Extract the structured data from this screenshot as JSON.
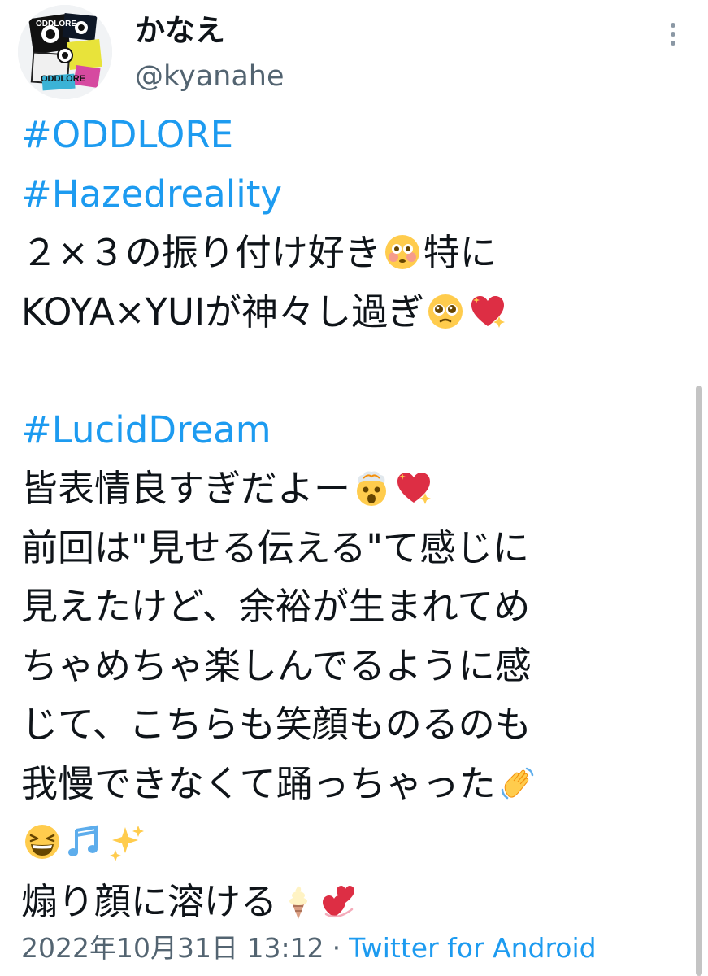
{
  "author": {
    "display_name": "かなえ",
    "handle": "@kyanahe",
    "avatar_text": [
      "ODDLORE",
      "ODDLORE"
    ]
  },
  "menu": {
    "more_icon": "vertical-ellipsis-icon"
  },
  "tweet": {
    "lines": [
      {
        "segments": [
          {
            "type": "hashtag",
            "text": "#ODDLORE"
          }
        ]
      },
      {
        "segments": [
          {
            "type": "hashtag",
            "text": "#Hazedreality"
          }
        ]
      },
      {
        "segments": [
          {
            "type": "text",
            "text": "２×３の振り付け好き"
          },
          {
            "type": "emoji",
            "name": "flushed-face-emoji"
          },
          {
            "type": "text",
            "text": "特に"
          }
        ]
      },
      {
        "segments": [
          {
            "type": "text",
            "text": "KOYA×YUIが神々し過ぎ"
          },
          {
            "type": "emoji",
            "name": "pleading-face-emoji"
          },
          {
            "type": "emoji",
            "name": "sparkling-heart-emoji"
          }
        ]
      },
      {
        "segments": []
      },
      {
        "segments": [
          {
            "type": "hashtag",
            "text": "#LucidDream"
          }
        ]
      },
      {
        "segments": [
          {
            "type": "text",
            "text": "皆表情良すぎだよー"
          },
          {
            "type": "emoji",
            "name": "exploding-head-emoji"
          },
          {
            "type": "emoji",
            "name": "sparkling-heart-emoji"
          }
        ]
      },
      {
        "segments": [
          {
            "type": "text",
            "text": "前回は\"見せる伝える\"て感じに"
          }
        ]
      },
      {
        "segments": [
          {
            "type": "text",
            "text": "見えたけど、余裕が生まれてめ"
          }
        ]
      },
      {
        "segments": [
          {
            "type": "text",
            "text": "ちゃめちゃ楽しんでるように感"
          }
        ]
      },
      {
        "segments": [
          {
            "type": "text",
            "text": "じて、こちらも笑顔ものるのも"
          }
        ]
      },
      {
        "segments": [
          {
            "type": "text",
            "text": "我慢できなくて踊っちゃった"
          },
          {
            "type": "emoji",
            "name": "waving-hand-emoji"
          }
        ]
      },
      {
        "segments": [
          {
            "type": "emoji",
            "name": "grinning-squinting-face-emoji"
          },
          {
            "type": "emoji",
            "name": "musical-notes-emoji"
          },
          {
            "type": "emoji",
            "name": "sparkles-emoji"
          }
        ]
      },
      {
        "segments": [
          {
            "type": "text",
            "text": "煽り顔に溶ける"
          },
          {
            "type": "emoji",
            "name": "soft-ice-cream-emoji"
          },
          {
            "type": "emoji",
            "name": "two-hearts-emoji"
          }
        ]
      }
    ]
  },
  "footer": {
    "timestamp": "2022年10月31日 13:12",
    "separator": "·",
    "source": "Twitter for Android"
  },
  "colors": {
    "link": "#1d9bf0",
    "text": "#0f1419",
    "secondary": "#536471"
  }
}
